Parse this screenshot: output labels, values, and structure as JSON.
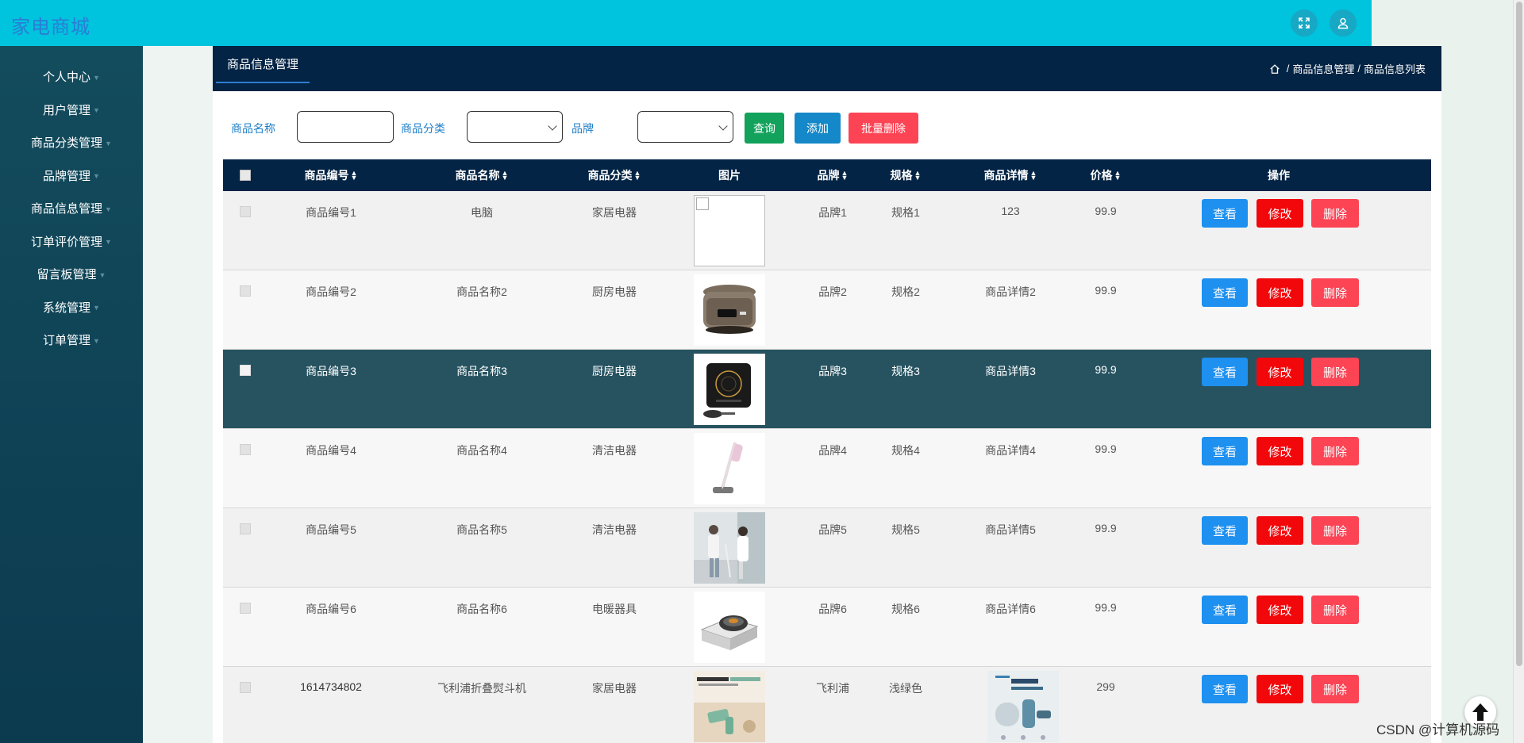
{
  "app": {
    "title": "家电商城"
  },
  "sidebar": {
    "items": [
      {
        "label": "个人中心"
      },
      {
        "label": "用户管理"
      },
      {
        "label": "商品分类管理"
      },
      {
        "label": "品牌管理"
      },
      {
        "label": "商品信息管理"
      },
      {
        "label": "订单评价管理"
      },
      {
        "label": "留言板管理"
      },
      {
        "label": "系统管理"
      },
      {
        "label": "订单管理"
      }
    ]
  },
  "header": {
    "tab_label": "商品信息管理",
    "breadcrumb": [
      "商品信息管理",
      "商品信息列表"
    ],
    "breadcrumb_sep": "/"
  },
  "search": {
    "name_label": "商品名称",
    "name_value": "",
    "category_label": "商品分类",
    "category_value": "",
    "brand_label": "品牌",
    "brand_value": "",
    "query_button": "查询",
    "add_button": "添加",
    "batch_delete_button": "批量删除"
  },
  "table": {
    "columns": [
      "商品编号",
      "商品名称",
      "商品分类",
      "图片",
      "品牌",
      "规格",
      "商品详情",
      "价格",
      "操作"
    ],
    "row_actions": {
      "view": "查看",
      "edit": "修改",
      "delete": "删除"
    },
    "rows": [
      {
        "id": "商品编号1",
        "name": "电脑",
        "category": "家居电器",
        "image": "broken",
        "brand": "品牌1",
        "spec": "规格1",
        "detail": "123",
        "price": "99.9"
      },
      {
        "id": "商品编号2",
        "name": "商品名称2",
        "category": "厨房电器",
        "image": "rice-cooker",
        "brand": "品牌2",
        "spec": "规格2",
        "detail": "商品详情2",
        "price": "99.9"
      },
      {
        "id": "商品编号3",
        "name": "商品名称3",
        "category": "厨房电器",
        "image": "induction-cooker",
        "brand": "品牌3",
        "spec": "规格3",
        "detail": "商品详情3",
        "price": "99.9"
      },
      {
        "id": "商品编号4",
        "name": "商品名称4",
        "category": "清洁电器",
        "image": "stick-vacuum",
        "brand": "品牌4",
        "spec": "规格4",
        "detail": "商品详情4",
        "price": "99.9"
      },
      {
        "id": "商品编号5",
        "name": "商品名称5",
        "category": "清洁电器",
        "image": "vacuum-lifestyle",
        "brand": "品牌5",
        "spec": "规格5",
        "detail": "商品详情5",
        "price": "99.9"
      },
      {
        "id": "商品编号6",
        "name": "商品名称6",
        "category": "电暖器具",
        "image": "heater-box",
        "brand": "品牌6",
        "spec": "规格6",
        "detail": "商品详情6",
        "price": "99.9"
      },
      {
        "id": "1614734802",
        "name": "飞利浦折叠熨斗机",
        "category": "家居电器",
        "image": "steamer-ad",
        "brand": "飞利浦",
        "spec": "浅绿色",
        "detail": "image",
        "price": "299"
      }
    ]
  },
  "watermark": "CSDN @计算机源码"
}
